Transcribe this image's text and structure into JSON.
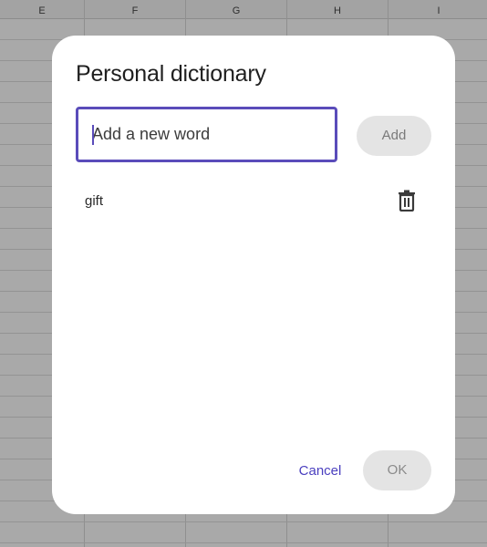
{
  "spreadsheet": {
    "columns": [
      "E",
      "F",
      "G",
      "H",
      "I"
    ]
  },
  "dialog": {
    "title": "Personal dictionary",
    "input_placeholder": "Add a new word",
    "input_value": "",
    "add_label": "Add",
    "words": [
      "gift"
    ],
    "delete_icon": "trash-icon",
    "cancel_label": "Cancel",
    "ok_label": "OK"
  },
  "colors": {
    "accent": "#5a4cba",
    "disabled_button_bg": "#e4e4e4",
    "overlay": "#a9a9a9"
  }
}
